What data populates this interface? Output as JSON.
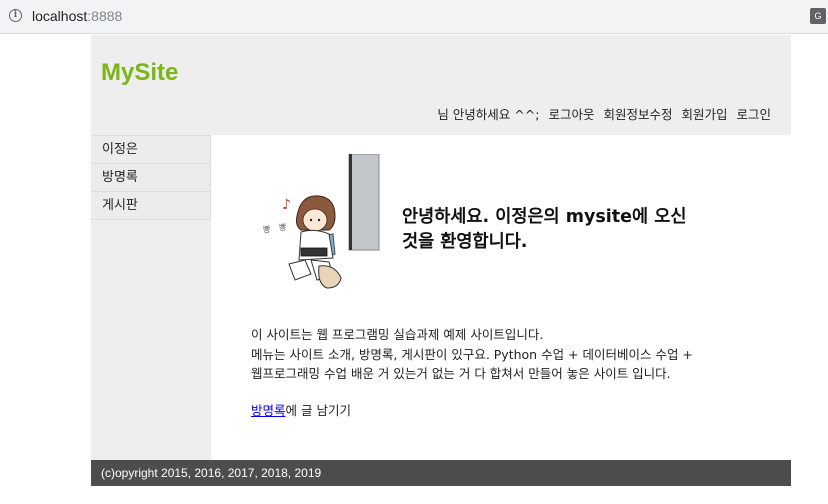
{
  "browser": {
    "url_host": "localhost",
    "url_port": ":8888",
    "info_icon": "info-icon",
    "translate_icon": "translate-icon"
  },
  "header": {
    "logo": "MySite",
    "logo_color": "#7cb518",
    "greeting": "님 안녕하세요 ^^;",
    "nav": [
      "로그아웃",
      "회원정보수정",
      "회원가입",
      "로그인"
    ]
  },
  "sidebar": {
    "items": [
      {
        "label": "이정은"
      },
      {
        "label": "방명록"
      },
      {
        "label": "게시판"
      }
    ]
  },
  "main": {
    "welcome_line1": "안녕하세요. 이정은의 mysite에 오신",
    "welcome_line2": "것을 환영합니다.",
    "desc_line1": "이 사이트는 웹 프로그램밍 실습과제 예제 사이트입니다.",
    "desc_line2": "메뉴는 사이트 소개, 방명록, 게시판이 있구요. Python 수업 + 데이터베이스 수업 +",
    "desc_line3": "웹프로그래밍 수업 배운 거 있는거 없는 거 다 합쳐서 만들어 놓은 사이트 입니다.",
    "guestbook_link": "방명록",
    "guestbook_suffix": "에 글 남기기"
  },
  "footer": {
    "copyright": "(c)opyright 2015, 2016, 2017, 2018, 2019"
  }
}
